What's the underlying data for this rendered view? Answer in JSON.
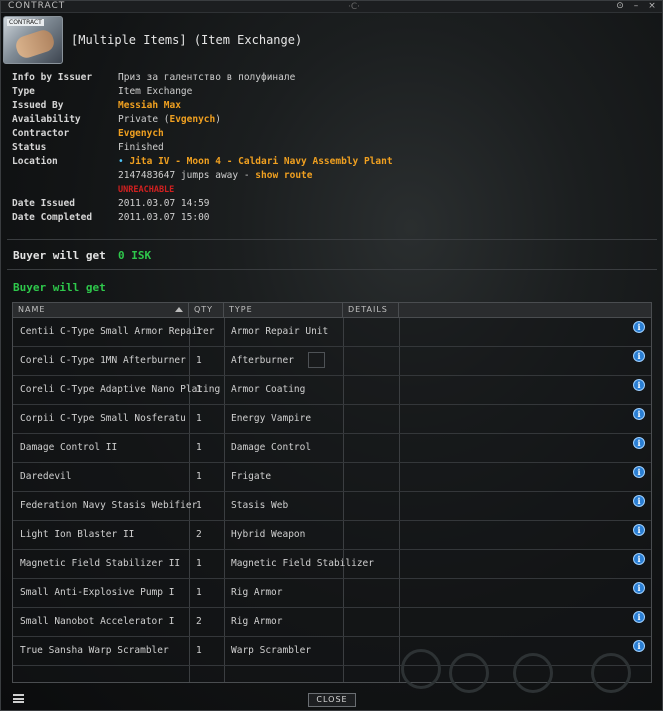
{
  "window": {
    "title": "CONTRACT",
    "controls": [
      "⊙",
      "–",
      "×"
    ],
    "logo_text": "·C·"
  },
  "header": {
    "icon_tag": "CONTRACT",
    "title": "[Multiple Items] (Item Exchange)"
  },
  "info": {
    "info_by_issuer_label": "Info by Issuer",
    "info_by_issuer_value": "Приз за галентство в полуфинале",
    "type_label": "Type",
    "type_value": "Item Exchange",
    "issued_by_label": "Issued By",
    "issued_by_value": "Messiah Max",
    "availability_label": "Availability",
    "availability_prefix": "Private (",
    "availability_name": "Evgenych",
    "availability_suffix": ")",
    "contractor_label": "Contractor",
    "contractor_value": "Evgenych",
    "status_label": "Status",
    "status_value": "Finished",
    "location_label": "Location",
    "location_bullet": "•",
    "location_value": "Jita IV - Moon 4 - Caldari Navy Assembly Plant",
    "jumps_text": "2147483647 jumps away - ",
    "show_route": "show route",
    "unreachable": "UNREACHABLE",
    "date_issued_label": "Date Issued",
    "date_issued_value": "2011.03.07 14:59",
    "date_completed_label": "Date Completed",
    "date_completed_value": "2011.03.07 15:00"
  },
  "buyer": {
    "will_get_1": "Buyer will get",
    "isk": "0 ISK",
    "will_get_2": "Buyer will get"
  },
  "table": {
    "headers": {
      "name": "NAME",
      "qty": "QTY",
      "type": "TYPE",
      "details": "DETAILS"
    },
    "rows": [
      {
        "name": "Centii C-Type Small Armor Repairer",
        "qty": "1",
        "type": "Armor Repair Unit"
      },
      {
        "name": "Coreli C-Type 1MN Afterburner",
        "qty": "1",
        "type": "Afterburner"
      },
      {
        "name": "Coreli C-Type Adaptive Nano Plating",
        "qty": "1",
        "type": "Armor Coating"
      },
      {
        "name": "Corpii C-Type Small Nosferatu",
        "qty": "1",
        "type": "Energy Vampire"
      },
      {
        "name": "Damage Control II",
        "qty": "1",
        "type": "Damage Control"
      },
      {
        "name": "Daredevil",
        "qty": "1",
        "type": "Frigate"
      },
      {
        "name": "Federation Navy Stasis Webifier",
        "qty": "1",
        "type": "Stasis Web"
      },
      {
        "name": "Light Ion Blaster II",
        "qty": "2",
        "type": "Hybrid Weapon"
      },
      {
        "name": "Magnetic Field Stabilizer II",
        "qty": "1",
        "type": "Magnetic Field Stabilizer"
      },
      {
        "name": "Small Anti-Explosive Pump I",
        "qty": "1",
        "type": "Rig Armor"
      },
      {
        "name": "Small Nanobot Accelerator I",
        "qty": "2",
        "type": "Rig Armor"
      },
      {
        "name": "True Sansha Warp Scrambler",
        "qty": "1",
        "type": "Warp Scrambler"
      }
    ],
    "info_glyph": "i"
  },
  "footer": {
    "close_label": "CLOSE"
  },
  "colors": {
    "accent_orange": "#f0a020",
    "isk_green": "#2ec84b",
    "unreachable_red": "#d02020",
    "info_blue": "#2b7fd4"
  }
}
